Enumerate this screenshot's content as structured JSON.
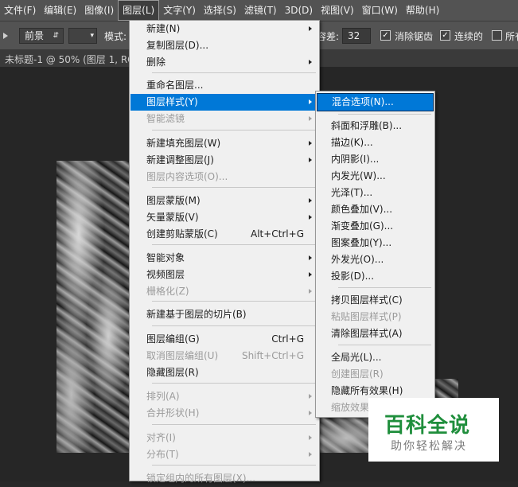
{
  "menubar": {
    "items": [
      "文件(F)",
      "编辑(E)",
      "图像(I)",
      "图层(L)",
      "文字(Y)",
      "选择(S)",
      "滤镜(T)",
      "3D(D)",
      "视图(V)",
      "窗口(W)",
      "帮助(H)"
    ],
    "active": "图层(L)"
  },
  "options_bar": {
    "fill_source": "前景",
    "mode_label": "模式:",
    "tolerance_label": "容差:",
    "tolerance_value": "32",
    "anti_alias_label": "消除锯齿",
    "contiguous_label": "连续的",
    "all_layers_label": "所有"
  },
  "document_tab": {
    "title": "未标题-1 @ 50% (图层 1, RG"
  },
  "layer_menu": {
    "items": [
      {
        "label": "新建(N)",
        "submenu": true
      },
      {
        "label": "复制图层(D)..."
      },
      {
        "label": "删除",
        "submenu": true
      },
      {
        "label": "重命名图层..."
      },
      {
        "label": "图层样式(Y)",
        "submenu": true,
        "highlighted": true
      },
      {
        "label": "智能滤镜",
        "submenu": true,
        "disabled": true
      },
      {
        "label": "新建填充图层(W)",
        "submenu": true
      },
      {
        "label": "新建调整图层(J)",
        "submenu": true
      },
      {
        "label": "图层内容选项(O)...",
        "disabled": true
      },
      {
        "label": "图层蒙版(M)",
        "submenu": true
      },
      {
        "label": "矢量蒙版(V)",
        "submenu": true
      },
      {
        "label": "创建剪贴蒙版(C)",
        "shortcut": "Alt+Ctrl+G"
      },
      {
        "label": "智能对象",
        "submenu": true
      },
      {
        "label": "视频图层",
        "submenu": true
      },
      {
        "label": "栅格化(Z)",
        "submenu": true,
        "disabled": true
      },
      {
        "label": "新建基于图层的切片(B)"
      },
      {
        "label": "图层编组(G)",
        "shortcut": "Ctrl+G"
      },
      {
        "label": "取消图层编组(U)",
        "shortcut": "Shift+Ctrl+G",
        "disabled": true
      },
      {
        "label": "隐藏图层(R)"
      },
      {
        "label": "排列(A)",
        "submenu": true,
        "disabled": true
      },
      {
        "label": "合并形状(H)",
        "submenu": true,
        "disabled": true
      },
      {
        "label": "对齐(I)",
        "submenu": true,
        "disabled": true
      },
      {
        "label": "分布(T)",
        "submenu": true,
        "disabled": true
      },
      {
        "label": "锁定组内的所有图层(X)...",
        "disabled": true
      }
    ]
  },
  "layer_style_menu": {
    "items": [
      {
        "label": "混合选项(N)...",
        "highlighted": true
      },
      {
        "label": "斜面和浮雕(B)..."
      },
      {
        "label": "描边(K)..."
      },
      {
        "label": "内阴影(I)..."
      },
      {
        "label": "内发光(W)..."
      },
      {
        "label": "光泽(T)..."
      },
      {
        "label": "颜色叠加(V)..."
      },
      {
        "label": "渐变叠加(G)..."
      },
      {
        "label": "图案叠加(Y)..."
      },
      {
        "label": "外发光(O)..."
      },
      {
        "label": "投影(D)..."
      },
      {
        "label": "拷贝图层样式(C)"
      },
      {
        "label": "粘贴图层样式(P)",
        "disabled": true
      },
      {
        "label": "清除图层样式(A)"
      },
      {
        "label": "全局光(L)..."
      },
      {
        "label": "创建图层(R)",
        "disabled": true
      },
      {
        "label": "隐藏所有效果(H)"
      },
      {
        "label": "缩放效果",
        "disabled": true
      }
    ]
  },
  "watermark": {
    "title": "百科全说",
    "subtitle": "助你轻松解决"
  },
  "colors": {
    "menu_highlight": "#0078d7",
    "menubar_bg": "#535353",
    "watermark_green": "#1f8e3c"
  }
}
